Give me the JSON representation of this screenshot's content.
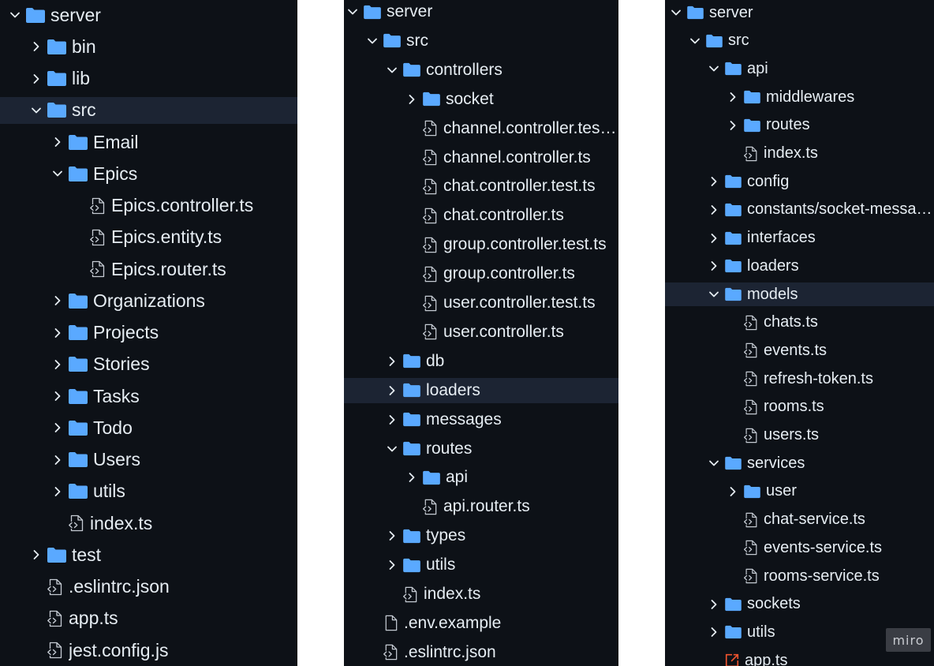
{
  "colors": {
    "background": "#0d1117",
    "text": "#e6edf3",
    "folder": "#5aa9ff",
    "file": "#c5cbd3",
    "selected_row": "#1c2433",
    "html_file_icon": "#f0542e"
  },
  "panels": [
    {
      "id": "panel-1",
      "rows": [
        {
          "label": "server",
          "type": "folder",
          "depth": 0,
          "expanded": true
        },
        {
          "label": "bin",
          "type": "folder",
          "depth": 1,
          "expanded": false
        },
        {
          "label": "lib",
          "type": "folder",
          "depth": 1,
          "expanded": false
        },
        {
          "label": "src",
          "type": "folder",
          "depth": 1,
          "expanded": true,
          "selected": true
        },
        {
          "label": "Email",
          "type": "folder",
          "depth": 2,
          "expanded": false
        },
        {
          "label": "Epics",
          "type": "folder",
          "depth": 2,
          "expanded": true
        },
        {
          "label": "Epics.controller.ts",
          "type": "file",
          "depth": 3
        },
        {
          "label": "Epics.entity.ts",
          "type": "file",
          "depth": 3
        },
        {
          "label": "Epics.router.ts",
          "type": "file",
          "depth": 3
        },
        {
          "label": "Organizations",
          "type": "folder",
          "depth": 2,
          "expanded": false
        },
        {
          "label": "Projects",
          "type": "folder",
          "depth": 2,
          "expanded": false
        },
        {
          "label": "Stories",
          "type": "folder",
          "depth": 2,
          "expanded": false
        },
        {
          "label": "Tasks",
          "type": "folder",
          "depth": 2,
          "expanded": false
        },
        {
          "label": "Todo",
          "type": "folder",
          "depth": 2,
          "expanded": false
        },
        {
          "label": "Users",
          "type": "folder",
          "depth": 2,
          "expanded": false
        },
        {
          "label": "utils",
          "type": "folder",
          "depth": 2,
          "expanded": false
        },
        {
          "label": "index.ts",
          "type": "file",
          "depth": 2
        },
        {
          "label": "test",
          "type": "folder",
          "depth": 1,
          "expanded": false
        },
        {
          "label": ".eslintrc.json",
          "type": "file",
          "depth": 1
        },
        {
          "label": "app.ts",
          "type": "file",
          "depth": 1
        },
        {
          "label": "jest.config.js",
          "type": "file",
          "depth": 1
        }
      ]
    },
    {
      "id": "panel-2",
      "rows": [
        {
          "label": "server",
          "type": "folder",
          "depth": 0,
          "expanded": true
        },
        {
          "label": "src",
          "type": "folder",
          "depth": 1,
          "expanded": true
        },
        {
          "label": "controllers",
          "type": "folder",
          "depth": 2,
          "expanded": true
        },
        {
          "label": "socket",
          "type": "folder",
          "depth": 3,
          "expanded": false
        },
        {
          "label": "channel.controller.test.ts",
          "type": "file",
          "depth": 3
        },
        {
          "label": "channel.controller.ts",
          "type": "file",
          "depth": 3
        },
        {
          "label": "chat.controller.test.ts",
          "type": "file",
          "depth": 3
        },
        {
          "label": "chat.controller.ts",
          "type": "file",
          "depth": 3
        },
        {
          "label": "group.controller.test.ts",
          "type": "file",
          "depth": 3
        },
        {
          "label": "group.controller.ts",
          "type": "file",
          "depth": 3
        },
        {
          "label": "user.controller.test.ts",
          "type": "file",
          "depth": 3
        },
        {
          "label": "user.controller.ts",
          "type": "file",
          "depth": 3
        },
        {
          "label": "db",
          "type": "folder",
          "depth": 2,
          "expanded": false
        },
        {
          "label": "loaders",
          "type": "folder",
          "depth": 2,
          "expanded": false,
          "selected": true
        },
        {
          "label": "messages",
          "type": "folder",
          "depth": 2,
          "expanded": false
        },
        {
          "label": "routes",
          "type": "folder",
          "depth": 2,
          "expanded": true
        },
        {
          "label": "api",
          "type": "folder",
          "depth": 3,
          "expanded": false
        },
        {
          "label": "api.router.ts",
          "type": "file",
          "depth": 3
        },
        {
          "label": "types",
          "type": "folder",
          "depth": 2,
          "expanded": false
        },
        {
          "label": "utils",
          "type": "folder",
          "depth": 2,
          "expanded": false
        },
        {
          "label": "index.ts",
          "type": "file",
          "depth": 2
        },
        {
          "label": ".env.example",
          "type": "doc",
          "depth": 1
        },
        {
          "label": ".eslintrc.json",
          "type": "file",
          "depth": 1
        }
      ]
    },
    {
      "id": "panel-3",
      "rows": [
        {
          "label": "server",
          "type": "folder",
          "depth": 0,
          "expanded": true
        },
        {
          "label": "src",
          "type": "folder",
          "depth": 1,
          "expanded": true
        },
        {
          "label": "api",
          "type": "folder",
          "depth": 2,
          "expanded": true
        },
        {
          "label": "middlewares",
          "type": "folder",
          "depth": 3,
          "expanded": false
        },
        {
          "label": "routes",
          "type": "folder",
          "depth": 3,
          "expanded": false
        },
        {
          "label": "index.ts",
          "type": "file",
          "depth": 3
        },
        {
          "label": "config",
          "type": "folder",
          "depth": 2,
          "expanded": false
        },
        {
          "label": "constants/socket-messages",
          "type": "folder",
          "depth": 2,
          "expanded": false
        },
        {
          "label": "interfaces",
          "type": "folder",
          "depth": 2,
          "expanded": false
        },
        {
          "label": "loaders",
          "type": "folder",
          "depth": 2,
          "expanded": false
        },
        {
          "label": "models",
          "type": "folder",
          "depth": 2,
          "expanded": true,
          "selected": true
        },
        {
          "label": "chats.ts",
          "type": "file",
          "depth": 3
        },
        {
          "label": "events.ts",
          "type": "file",
          "depth": 3
        },
        {
          "label": "refresh-token.ts",
          "type": "file",
          "depth": 3
        },
        {
          "label": "rooms.ts",
          "type": "file",
          "depth": 3
        },
        {
          "label": "users.ts",
          "type": "file",
          "depth": 3
        },
        {
          "label": "services",
          "type": "folder",
          "depth": 2,
          "expanded": true
        },
        {
          "label": "user",
          "type": "folder",
          "depth": 3,
          "expanded": false
        },
        {
          "label": "chat-service.ts",
          "type": "file",
          "depth": 3
        },
        {
          "label": "events-service.ts",
          "type": "file",
          "depth": 3
        },
        {
          "label": "rooms-service.ts",
          "type": "file",
          "depth": 3
        },
        {
          "label": "sockets",
          "type": "folder",
          "depth": 2,
          "expanded": false
        },
        {
          "label": "utils",
          "type": "folder",
          "depth": 2,
          "expanded": false
        },
        {
          "label": "app.ts",
          "type": "html",
          "depth": 2
        }
      ]
    }
  ],
  "watermark": "miro"
}
